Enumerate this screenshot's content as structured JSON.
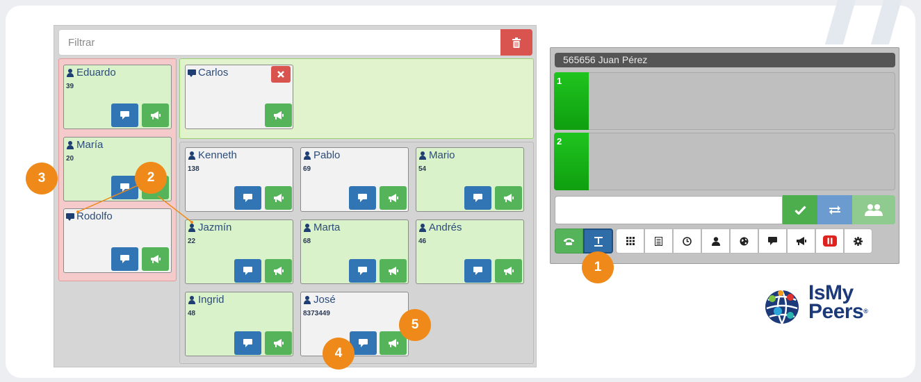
{
  "filter": {
    "placeholder": "Filtrar",
    "delete_icon": "trash-icon"
  },
  "agents": [
    {
      "name": "Eduardo",
      "ext": "39"
    },
    {
      "name": "María",
      "ext": "20"
    },
    {
      "name": "Rodolfo",
      "ext": ""
    },
    {
      "name": "Carlos",
      "ext": ""
    },
    {
      "name": "Kenneth",
      "ext": "138"
    },
    {
      "name": "Pablo",
      "ext": "69"
    },
    {
      "name": "Mario",
      "ext": "54"
    },
    {
      "name": "Jazmín",
      "ext": "22"
    },
    {
      "name": "Marta",
      "ext": "68"
    },
    {
      "name": "Andrés",
      "ext": "46"
    },
    {
      "name": "Ingrid",
      "ext": "48"
    },
    {
      "name": "José",
      "ext": "8373449"
    }
  ],
  "softphone": {
    "title": "565656 Juan Pérez",
    "lines": [
      {
        "label": "1"
      },
      {
        "label": "2"
      }
    ],
    "dial_input": "",
    "action_icons": [
      "check-icon",
      "transfer-icon",
      "conference-icon"
    ],
    "mode_icons": [
      "phone-icon",
      "text-icon"
    ],
    "toolbar_icons": [
      "keypad-icon",
      "list-icon",
      "clock-icon",
      "user-icon",
      "globe-icon",
      "chat-icon",
      "megaphone-icon",
      "record-icon",
      "gear-icon"
    ]
  },
  "callouts": [
    "1",
    "2",
    "3",
    "4",
    "5"
  ],
  "logo": {
    "line1": "IsMy",
    "line2": "Peers",
    "mark": "®"
  },
  "colors": {
    "ready": "#d9f2c9",
    "idle": "#f2f2f2",
    "chat_button": "#3275b5",
    "broadcast_button": "#55b35a",
    "delete": "#d9534f",
    "callout": "#ef8a1a",
    "line_active": "#17b417"
  }
}
